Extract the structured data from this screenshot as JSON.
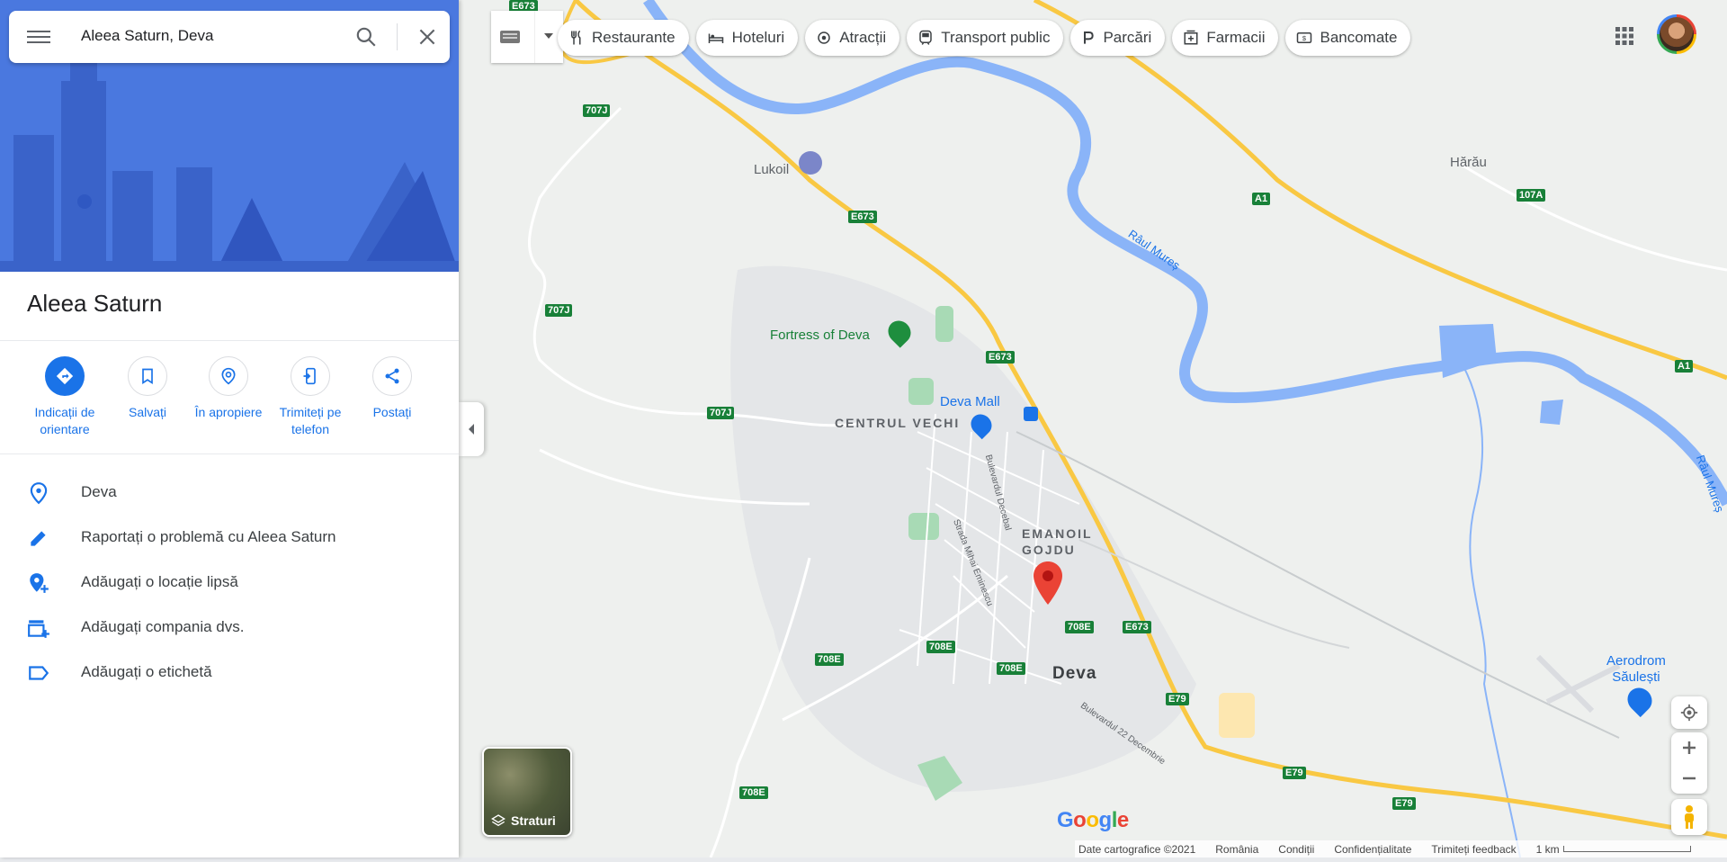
{
  "search": {
    "query": "Aleea Saturn, Deva"
  },
  "place": {
    "title": "Aleea Saturn"
  },
  "actions": [
    {
      "label": "Indicații de orientare"
    },
    {
      "label": "Salvați"
    },
    {
      "label": "În apropiere"
    },
    {
      "label": "Trimiteți pe telefon"
    },
    {
      "label": "Postați"
    }
  ],
  "rows": [
    {
      "text": "Deva",
      "icon": "location-pin-icon"
    },
    {
      "text": "Raportați o problemă cu Aleea Saturn",
      "icon": "pencil-icon"
    },
    {
      "text": "Adăugați o locație lipsă",
      "icon": "add-location-icon"
    },
    {
      "text": "Adăugați compania dvs.",
      "icon": "add-business-icon"
    },
    {
      "text": "Adăugați o etichetă",
      "icon": "label-icon"
    }
  ],
  "chips": [
    {
      "label": "Restaurante",
      "icon": "restaurant-icon"
    },
    {
      "label": "Hoteluri",
      "icon": "hotel-icon"
    },
    {
      "label": "Atracții",
      "icon": "attractions-icon"
    },
    {
      "label": "Transport public",
      "icon": "transit-icon"
    },
    {
      "label": "Parcări",
      "icon": "parking-icon"
    },
    {
      "label": "Farmacii",
      "icon": "pharmacy-icon"
    },
    {
      "label": "Bancomate",
      "icon": "atm-icon"
    }
  ],
  "layers": {
    "label": "Straturi"
  },
  "map": {
    "places": {
      "lukoil": "Lukoil",
      "fortress": "Fortress of Deva",
      "mall": "Deva Mall",
      "centru_vechi": "CENTRUL VECHI",
      "emanoil_gojdu": "EMANOIL\nGOJDU",
      "deva": "Deva",
      "harau": "Hărău",
      "aerodrom": "Aerodrom\nSăulești",
      "raul_mures_1": "Râul Mureș",
      "raul_mures_2": "Râul Mureș",
      "bulevardul_decebal": "Bulevardul Decebal",
      "strada_eminescu": "Strada Mihai Eminescu",
      "bulevardul_22": "Bulevardul 22 Decembrie"
    },
    "shields": {
      "e673_top": "E673",
      "r707j_a": "707J",
      "e673_a": "E673",
      "r707j_b": "707J",
      "e673_b": "E673",
      "r707j_c": "707J",
      "a1_a": "A1",
      "r107a": "107A",
      "a1_b": "A1",
      "r708e_a": "708E",
      "e673_c": "E673",
      "r708e_b": "708E",
      "r708e_c": "708E",
      "r708e_d": "708E",
      "e79_a": "E79",
      "e79_b": "E79",
      "e79_c": "E79",
      "r708e_e": "708E"
    }
  },
  "footer": {
    "data": "Date cartografice ©2021",
    "country": "România",
    "terms": "Condiții",
    "privacy": "Confidențialitate",
    "feedback": "Trimiteți feedback",
    "scale": "1 km"
  },
  "google_logo": "Google",
  "colors": {
    "accent": "#1a73e8",
    "river": "#8ab4f8",
    "highway": "#f9c843",
    "pin": "#ea4335",
    "park": "#a8dab5"
  }
}
